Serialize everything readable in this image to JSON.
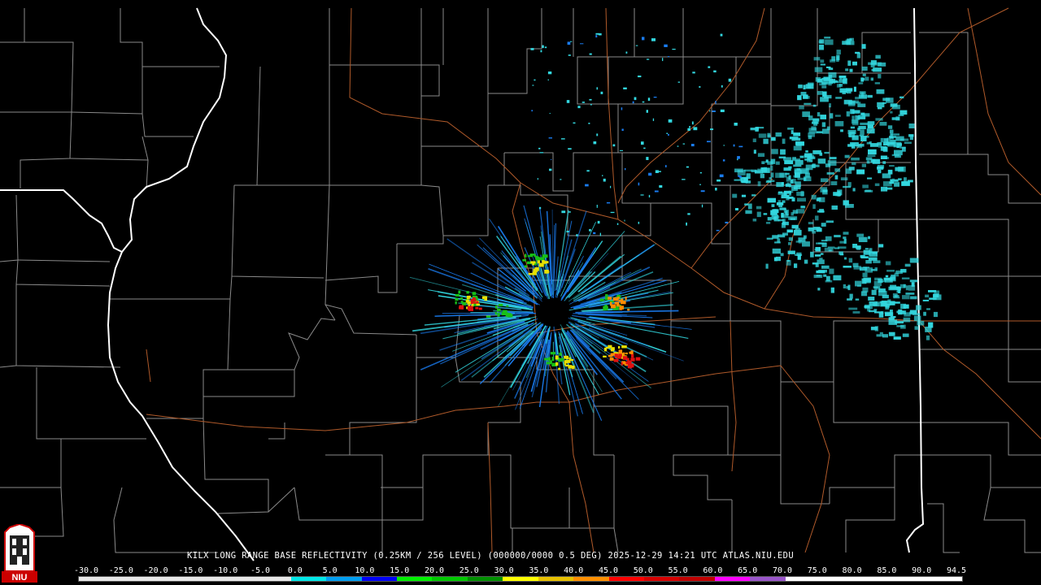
{
  "caption": "KILX LONG RANGE BASE REFLECTIVITY (0.25KM / 256 LEVEL) (000000/0000 0.5 DEG) 2025-12-29 14:21 UTC  ATLAS.NIU.EDU",
  "scale": {
    "labels": [
      "-30.0",
      "-25.0",
      "-20.0",
      "-15.0",
      "-10.0",
      "-5.0",
      "0.0",
      "5.0",
      "10.0",
      "15.0",
      "20.0",
      "25.0",
      "30.0",
      "35.0",
      "40.0",
      "45.0",
      "50.0",
      "55.0",
      "60.0",
      "65.0",
      "70.0",
      "75.0",
      "80.0",
      "85.0",
      "90.0",
      "94.5"
    ],
    "colors": [
      "#e8e8e8",
      "#e8e8e8",
      "#e8e8e8",
      "#e8e8e8",
      "#e8e8e8",
      "#e8e8e8",
      "#00e8e8",
      "#009ef0",
      "#0000f6",
      "#00f000",
      "#00c800",
      "#009000",
      "#ffff00",
      "#e7c000",
      "#ff9000",
      "#ff0000",
      "#d60000",
      "#c00000",
      "#ff00ff",
      "#9955c9",
      "#ffffff",
      "#ffffff",
      "#ffffff",
      "#ffffff",
      "#ffffff"
    ]
  },
  "logo": {
    "text": "NIU",
    "icon": "niu-tower-icon"
  },
  "colors": {
    "background": "#000000",
    "state_border": "#ffffff",
    "county_border": "#8a8a8a",
    "highway": "#b05a2a",
    "echo_light": "#33d8e0",
    "echo_medium": "#1a7cf0",
    "echo_green": "#18c018",
    "echo_yellow": "#e8e000",
    "echo_orange": "#ff8c00",
    "echo_red": "#e01010"
  }
}
